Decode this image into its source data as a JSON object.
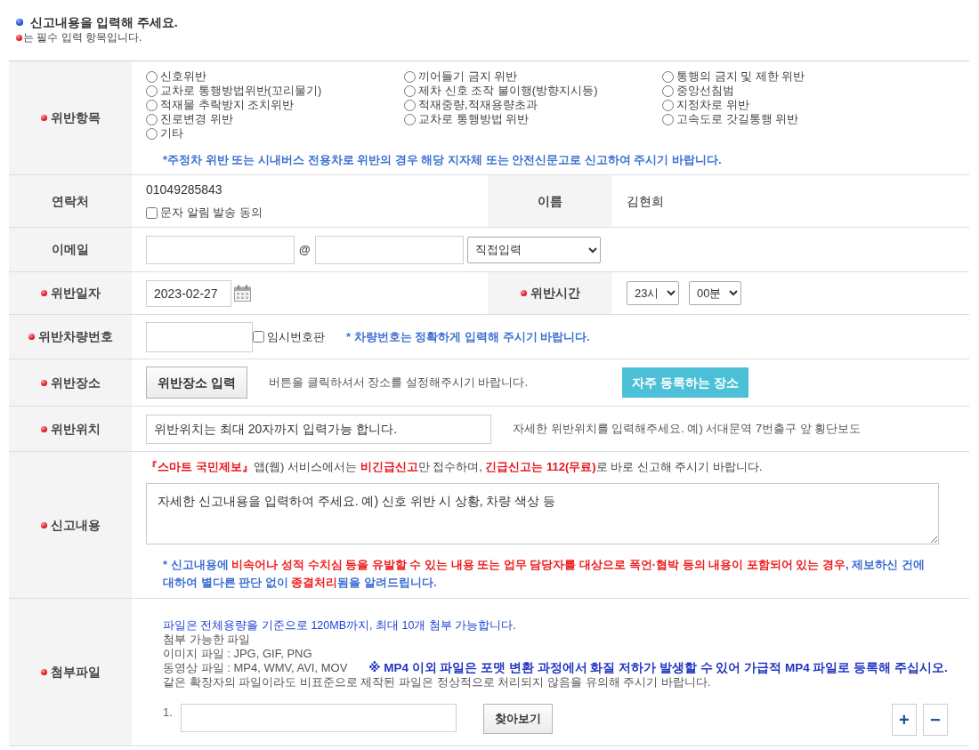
{
  "header": {
    "title": "신고내용을 입력해 주세요.",
    "required_note": "는 필수 입력 항목입니다."
  },
  "violation": {
    "label": "위반항목",
    "required": true,
    "options": [
      {
        "label": "신호위반",
        "selected": false
      },
      {
        "label": "끼어들기 금지 위반",
        "selected": false
      },
      {
        "label": "통행의 금지 및 제한 위반",
        "selected": false
      },
      {
        "label": "교차로 통행방법위반(꼬리물기)",
        "selected": false
      },
      {
        "label": "제차 신호 조작 불이행(방향지시등)",
        "selected": false
      },
      {
        "label": "중앙선침범",
        "selected": false
      },
      {
        "label": "적재물 추락방지 조치위반",
        "selected": false
      },
      {
        "label": "적재중량,적재용량초과",
        "selected": false
      },
      {
        "label": "지정차로 위반",
        "selected": false
      },
      {
        "label": "진로변경 위반",
        "selected": false
      },
      {
        "label": "교차로 통행방법 위반",
        "selected": false
      },
      {
        "label": "고속도로 갓길통행 위반",
        "selected": false
      },
      {
        "label": "기타",
        "selected": false
      }
    ],
    "note": "*주정차 위반 또는 시내버스 전용차로 위반의 경우 해당 지자체 또는 안전신문고로 신고하여 주시기 바랍니다."
  },
  "contact": {
    "label": "연락처",
    "required": false,
    "phone": "01049285843",
    "sms_consent": {
      "label": "문자 알림 발송 동의",
      "checked": false
    },
    "name_label": "이름",
    "name_required": false,
    "name": "김현희"
  },
  "email": {
    "label": "이메일",
    "required": false,
    "at": "@",
    "domain_select": "직접입력"
  },
  "date": {
    "label": "위반일자",
    "required": true,
    "value": "2023-02-27",
    "time_label": "위반시간",
    "time_required": true,
    "hour": "23시",
    "minute": "00분"
  },
  "plate": {
    "label": "위반차량번호",
    "required": true,
    "temporary": {
      "label": "임시번호판",
      "checked": false
    },
    "note": "* 차량번호는 정확하게 입력해 주시기 바랍니다."
  },
  "place": {
    "label": "위반장소",
    "required": true,
    "button": "위반장소 입력",
    "hint": "버튼을 클릭하셔서 장소를 설정해주시기 바랍니다.",
    "favorites_button": "자주 등록하는 장소"
  },
  "location": {
    "label": "위반위치",
    "required": true,
    "placeholder": "위반위치는 최대 20자까지 입력가능 합니다.",
    "hint": "자세한 위반위치를 입력해주세요. 예) 서대문역 7번출구 앞 횡단보도"
  },
  "content": {
    "label": "신고내용",
    "required": true,
    "notice": [
      {
        "text": "『스마트 국민제보』",
        "highlight": true
      },
      {
        "text": "앱(웹) 서비스에서는 ",
        "highlight": false
      },
      {
        "text": "비긴급신고",
        "highlight": true
      },
      {
        "text": "만 접수하며, ",
        "highlight": false
      },
      {
        "text": "긴급신고는 112(무료)",
        "highlight": true
      },
      {
        "text": "로 바로 신고해 주시기 바랍니다.",
        "highlight": false
      }
    ],
    "placeholder": "자세한 신고내용을 입력하여 주세요. 예) 신호 위반 시 상황, 차량 색상 등",
    "warning": [
      {
        "text": "* 신고내용에 ",
        "highlight": false
      },
      {
        "text": "비속어나 성적 수치심 등을 유발할 수 있는 내용 또는 업무 담당자를 대상으로 폭언·협박 등의 내용이 포함되어 있는 경우",
        "highlight": true
      },
      {
        "text": ", 제보하신 건에 대하여 별다른 판단 없이 ",
        "highlight": false
      },
      {
        "text": "종결처리",
        "highlight": true
      },
      {
        "text": "됨을 알려드립니다.",
        "highlight": false
      }
    ]
  },
  "attachment": {
    "label": "첨부파일",
    "required": true,
    "limit_note": "파일은 전체용량을 기준으로 120MB까지, 최대 10개 첨부 가능합니다.",
    "allowed_title": "첨부 가능한 파일",
    "image_types": "이미지 파일 : JPG, GIF, PNG",
    "video_types": "동영상 파일 : MP4, WMV, AVI, MOV",
    "video_note": "※ MP4 이외 파일은 포맷 변환 과정에서 화질 저하가 발생할 수 있어 가급적 MP4 파일로 등록해 주십시오.",
    "standard_note": "같은 확장자의 파일이라도 비표준으로 제작된 파일은 정상적으로 처리되지 않음을 유의해 주시기 바랍니다.",
    "files": [
      {
        "number": "1."
      }
    ],
    "browse_button": "찾아보기",
    "add_button": "+",
    "remove_button": "−"
  }
}
